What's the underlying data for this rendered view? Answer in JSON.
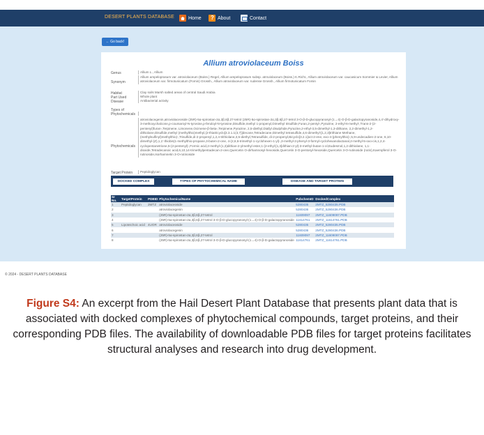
{
  "nav": {
    "brand": "DESERT PLANTS DATABASE",
    "home": "Home",
    "about": "About",
    "contact": "Contact"
  },
  "back_button": "← Go back!",
  "plant": {
    "title": "Allium atroviolaceum Boiss",
    "fields": [
      {
        "label": "Genus",
        "value": "Allium L., Allium"
      },
      {
        "label": "Synonym",
        "value": "Allium ampeloprasum var. atroviolaceum (Boiss.) Regel, Allium ampeloprasum subsp. atroviolaceum (Boiss.) K.Richt., Allium atroviolaceum var. caucasicum Sommier & Levier, Allium atroviolaceum var. firmotunicatum (Fomin) Grossh., Allium atroviolaceum var. rudense Grossh., Allium firmotunicatum Fomin"
      },
      {
        "label": "Habitat",
        "value": "Clay soils Marsh salted areas of central Saudi Arabia"
      },
      {
        "label": "Part Used",
        "value": "Whole plant"
      },
      {
        "label": "Disease",
        "value": "Antibacterial activity"
      },
      {
        "label": "Types of Phytochemicals",
        "value": ""
      },
      {
        "label": "Phytochemicals",
        "value": "atroviolacegenin,atroviolaceoside (25R)-5α-spirostan-2α,3β,6β,27-tetrol (25R)-5α-spirostan-2α,3β,6β,27-tetrol 3-O-β-D-glucopyranosyl-(1→4)-O-β-D-galactopyranoside,4,4'-dihydroxy-3-methoxychalcone,p-coumaroyl-N-tyrosine,p-feruloyl-N-tyrosine,Disulfide,methyl 1-propenyl,Dimethyl trisulfide,Furan,2-pentyl-,Pyrazine, 2-ethyl-6-methyl-,Trans-2-(2-pentenyl)furan-,Terpinene, Limonene,Ocimene-β-beta-,Terpinene,Pyrazine, 2,5-diethyl,Diallyl disulphide,Pyrazine,2-ethyl-3,5-dimethyl-1,3-dithiane, 2,2-dimethyl-1,2-dithiolane,Disulfide,methyl (methylthio)methyl,(2-thiatricyclo[3.3.1.1(3,7)]decane,Tetradecane,Dimethyl tetrasulfide,4,6-dimethyl-[1,2,3]trithiane Methane,(methylsulfinyl)methylthio)-,Trisulfide,di-2-propenyl,1,2,4-trithiolane,3,5-diethyl,Tetrasulfide, di-2-propenyl,Bicyclo[3.2.1]oct-2-ene, exo-4-(phenylthio)-,5,9-undecadien-2-one, 6,10-dimethyl-(Z),1,1'-thiobis(1-methylthio-propane,3-buten-2-one, 4-(2,6,6-trimethyl-1-cyclohexen-1-yl)-,3-methyl-2-phenyl-3-formyl-cyclohexanolactanal,2-methyl-5-oxo-cis,1,2,4-cyclopentanetrione,5-(2-pentenyl)-,Formic acid,2-methyl-(1,3)dithian-2-ylmethyl ester,1-(2-ethyl-[1,3]dithian-2-yl)-3-methyl-butan-1-ol,Eudesmol,1,2-dithiolane, 1,1-dioxide,Tetradecanoic acid,6,10,14-trimethylpentadecan-2-one,Quercetin O-dirhamnosyl-hexoside,Quercetin 3-O-pentosyl-hexoside,Quercetin 3-O-rutinoside (rutin),Kaempferol 3-O-rutinoside,Isorhamnetin 3-O-rutinoside"
      },
      {
        "label": "Target Protein",
        "value": "Peptidoglycan"
      }
    ]
  },
  "tabs": [
    "DOCKED COMPLEX",
    "TYPES OF PHYTOCHEMICAL NAME",
    "DISEASE AND TARGET PROTEIN"
  ],
  "docked_table": {
    "headers": [
      "Sr No.",
      "TargetProtein",
      "PDBID",
      "PhytochemicalName",
      "PubchemID",
      "DockedComplex"
    ],
    "rows": [
      [
        "1",
        "Peptidoglycan",
        "2MTZ",
        "atroviolaceoside",
        "5280435",
        "2MTZ_5280435.PDB"
      ],
      [
        "2",
        "",
        "",
        "atroviolacegenin",
        "5280436",
        "2MTZ_5280436.PDB"
      ],
      [
        "3",
        "",
        "",
        "(25R)-5α-spirostan-2α,3β,6β,27-tetrol",
        "11609097",
        "2MTZ_11609097.PDB"
      ],
      [
        "4",
        "",
        "",
        "(25R)-5α-spirostan-2α,3β,6β,27-tetrol 3-O-β-D-glucopyranosyl-(1→4)-O-β-D-galactopyranoside",
        "11614761",
        "2MTZ_11614761.PDB"
      ],
      [
        "5",
        "Lipoteichoic acid",
        "4UOR",
        "atroviolaceoside",
        "5280435",
        "2MTZ_5280435.PDB"
      ],
      [
        "6",
        "",
        "",
        "atroviolacegenin",
        "5280436",
        "2MTZ_5280436.PDB"
      ],
      [
        "7",
        "",
        "",
        "(25R)-5α-spirostan-2α,3β,6β,27-tetrol",
        "11609097",
        "2MTZ_11609097.PDB"
      ],
      [
        "8",
        "",
        "",
        "(25R)-5α-spirostan-2α,3β,6β,27-tetrol 3-O-β-D-glucopyranosyl-(1→4)-O-β-D-galactopyranoside",
        "11614761",
        "2MTZ_11614761.PDB"
      ]
    ]
  },
  "footer": "© 2024 - DESERT PLANTS DATABASE",
  "caption": {
    "label": "Figure S4:",
    "text": " An excerpt from the Hail Desert Plant Database that presents plant data that is associated with docked complexes of phytochemical compounds, target proteins, and their corresponding PDB files. The availability of downloadable PDB files for target proteins facilitates structural analyses and research into drug development."
  },
  "colors": {
    "navbar": "#1f3f68",
    "brand": "#ffb94d",
    "page_background": "#d7e8f6",
    "title": "#2f72c4",
    "caption_label": "#c13a1c"
  }
}
